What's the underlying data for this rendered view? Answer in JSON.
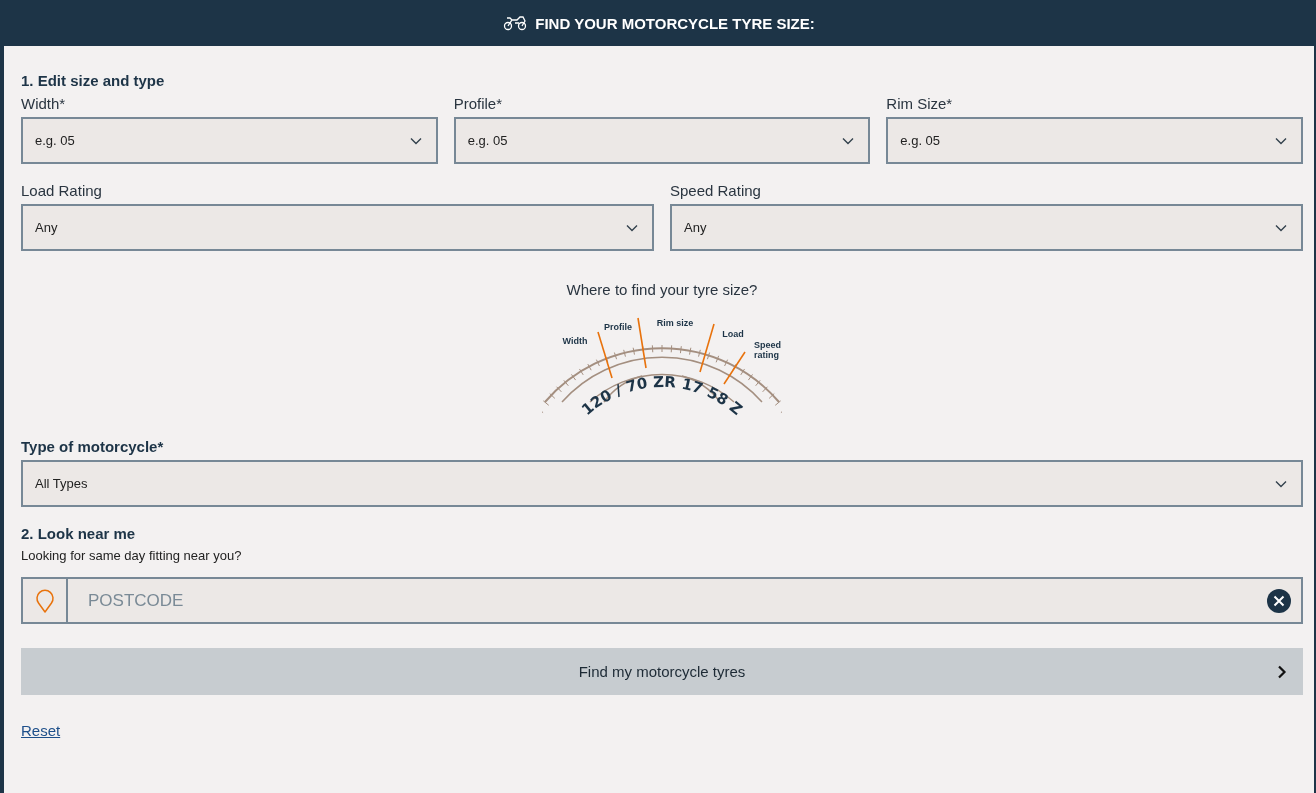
{
  "header": {
    "title": "FIND YOUR MOTORCYCLE TYRE SIZE:"
  },
  "section1": {
    "heading": "1. Edit size and type",
    "size_fields": [
      {
        "label": "Width*",
        "value": "e.g. 05"
      },
      {
        "label": "Profile*",
        "value": "e.g. 05"
      },
      {
        "label": "Rim Size*",
        "value": "e.g. 05"
      }
    ],
    "rating_fields": [
      {
        "label": "Load Rating",
        "value": "Any"
      },
      {
        "label": "Speed Rating",
        "value": "Any"
      }
    ],
    "diagram": {
      "caption": "Where to find your tyre size?",
      "sidewall": "120 / 70 ZR 17 58 Z",
      "labels": [
        "Width",
        "Profile",
        "Rim size",
        "Load",
        "Speed rating"
      ]
    },
    "type_field": {
      "label": "Type of motorcycle*",
      "value": "All Types"
    }
  },
  "section2": {
    "heading": "2. Look near me",
    "subtitle": "Looking for same day fitting near you?",
    "postcode": {
      "placeholder": "POSTCODE"
    }
  },
  "submit": {
    "label": "Find my motorcycle tyres",
    "disabled": true
  },
  "reset": "Reset"
}
